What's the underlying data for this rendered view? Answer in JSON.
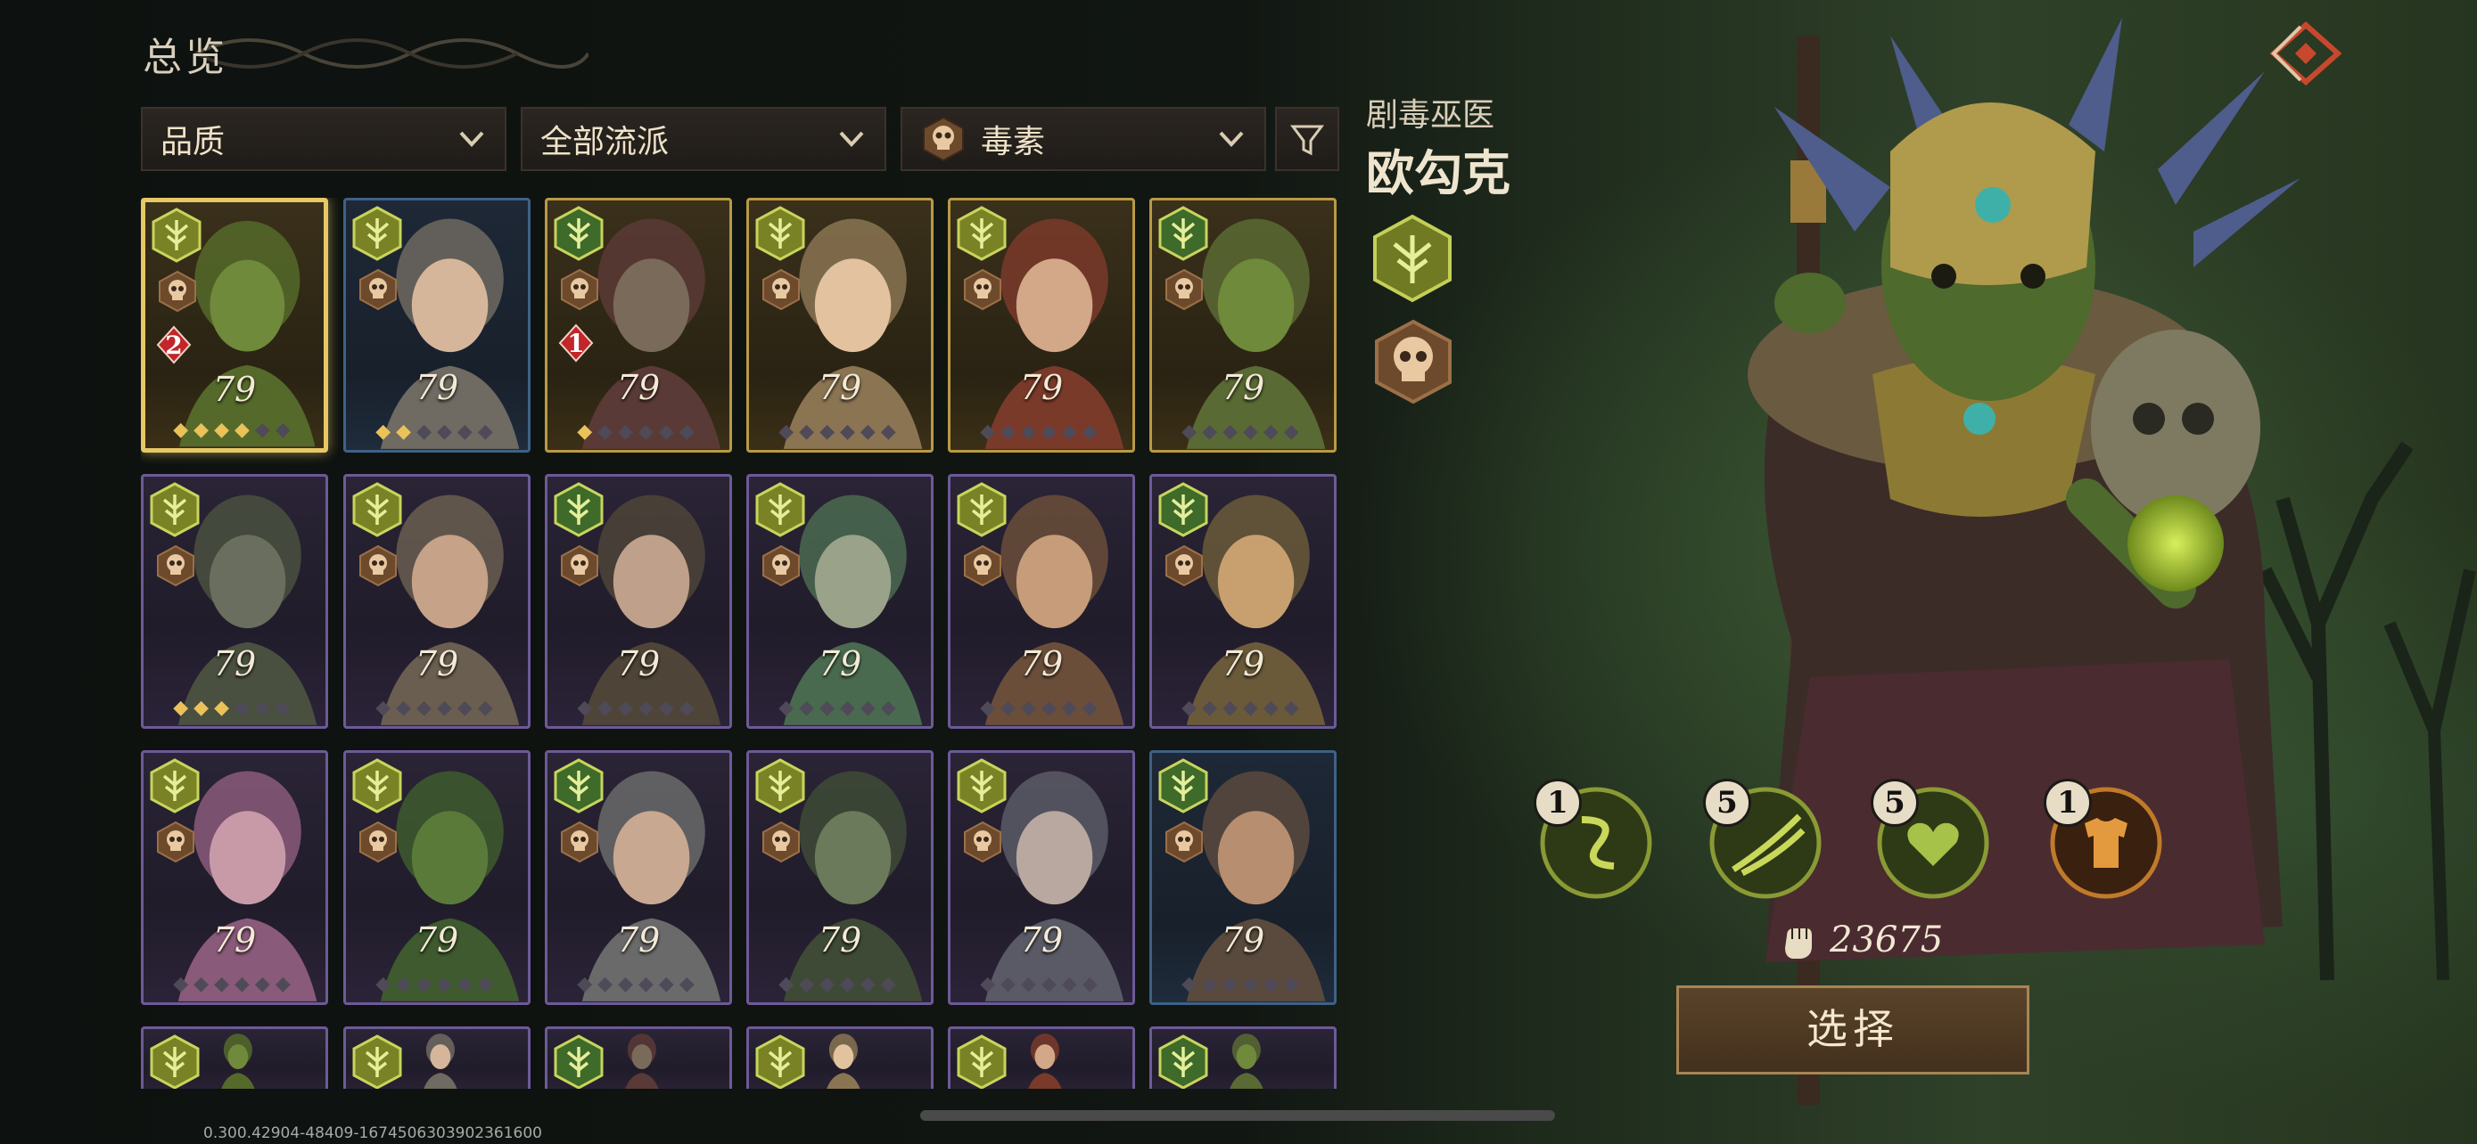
{
  "header": {
    "title": "总览"
  },
  "filters": {
    "quality": "品质",
    "school": "全部流派",
    "toxin": "毒素"
  },
  "heroes": [
    {
      "level": "79",
      "frame": "gold",
      "stars": 4,
      "rank": "2",
      "selected": true
    },
    {
      "level": "79",
      "frame": "blue",
      "stars": 2
    },
    {
      "level": "79",
      "frame": "gold",
      "stars": 1,
      "rank": "1"
    },
    {
      "level": "79",
      "frame": "gold",
      "stars": 0
    },
    {
      "level": "79",
      "frame": "gold",
      "stars": 0
    },
    {
      "level": "79",
      "frame": "gold",
      "stars": 0
    },
    {
      "level": "79",
      "frame": "purple",
      "stars": 3
    },
    {
      "level": "79",
      "frame": "purple",
      "stars": 0
    },
    {
      "level": "79",
      "frame": "purple",
      "stars": 0
    },
    {
      "level": "79",
      "frame": "purple",
      "stars": 0
    },
    {
      "level": "79",
      "frame": "purple",
      "stars": 0
    },
    {
      "level": "79",
      "frame": "purple",
      "stars": 0
    },
    {
      "level": "79",
      "frame": "purple",
      "stars": 0
    },
    {
      "level": "79",
      "frame": "purple",
      "stars": 0
    },
    {
      "level": "79",
      "frame": "purple",
      "stars": 0
    },
    {
      "level": "79",
      "frame": "purple",
      "stars": 0
    },
    {
      "level": "79",
      "frame": "purple",
      "stars": 0
    },
    {
      "level": "79",
      "frame": "blue",
      "stars": 0
    }
  ],
  "selected_hero": {
    "subtitle": "剧毒巫医",
    "name": "欧勾克",
    "skills": [
      {
        "count": "1",
        "icon": "swirl-skill-icon"
      },
      {
        "count": "5",
        "icon": "slash-skill-icon"
      },
      {
        "count": "5",
        "icon": "heart-skill-icon"
      },
      {
        "count": "1",
        "icon": "armor-skill-icon"
      }
    ],
    "power": "23675",
    "select_label": "选择"
  },
  "version": "0.300.42904-48409-1674506303902361600",
  "colors": {
    "gold_frame": "#b99a44",
    "purple_frame": "#6d5a98",
    "blue_frame": "#3f6187",
    "class_green": "#9cac3a"
  }
}
